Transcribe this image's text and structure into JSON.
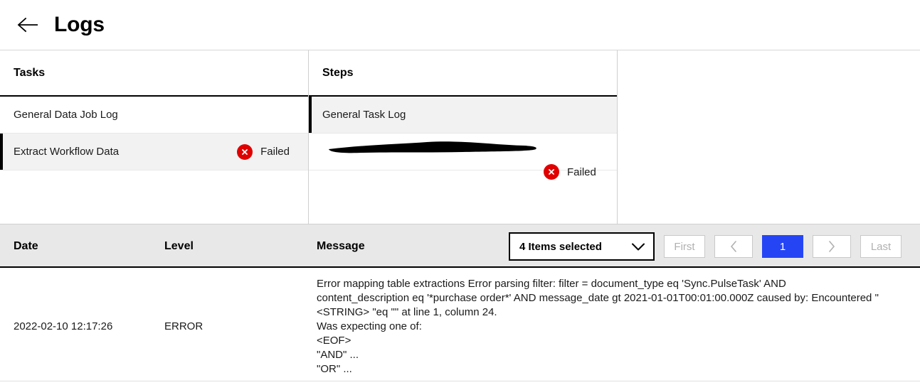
{
  "header": {
    "back_icon": "arrow-left-icon",
    "title": "Logs"
  },
  "panels": {
    "tasks": {
      "heading": "Tasks",
      "rows": [
        {
          "label": "General Data Job Log",
          "status": "",
          "selected": false
        },
        {
          "label": "Extract Workflow Data",
          "status": "Failed",
          "selected": true
        }
      ]
    },
    "steps": {
      "heading": "Steps",
      "rows": [
        {
          "label": "General Task Log",
          "status": "",
          "selected": true
        },
        {
          "label": "",
          "status": "Failed",
          "selected": false,
          "redacted": true
        }
      ]
    }
  },
  "log_table": {
    "columns": {
      "date": "Date",
      "level": "Level",
      "message": "Message"
    },
    "pagination": {
      "items_selected": "4 Items selected",
      "chevron_icon": "chevron-down-icon",
      "first": "First",
      "prev_icon": "chevron-left-icon",
      "current_page": "1",
      "next_icon": "chevron-right-icon",
      "last": "Last"
    },
    "rows": [
      {
        "date": "2022-02-10 12:17:26",
        "level": "ERROR",
        "message": "Error mapping table extractions Error parsing filter: filter = document_type eq 'Sync.PulseTask' AND content_description eq '*purchase order*' AND message_date gt 2021-01-01T00:01:00.000Z caused by: Encountered \" <STRING> \"eq \"\" at line 1, column 24.\nWas expecting one of:\n<EOF>\n\"AND\" ...\n\"OR\" ..."
      }
    ]
  },
  "status_labels": {
    "failed": "Failed"
  },
  "colors": {
    "error_red": "#e00000",
    "page_active_blue": "#2545f5",
    "selected_row_bg": "#f2f2f2",
    "table_header_bg": "#e8e8e8"
  }
}
